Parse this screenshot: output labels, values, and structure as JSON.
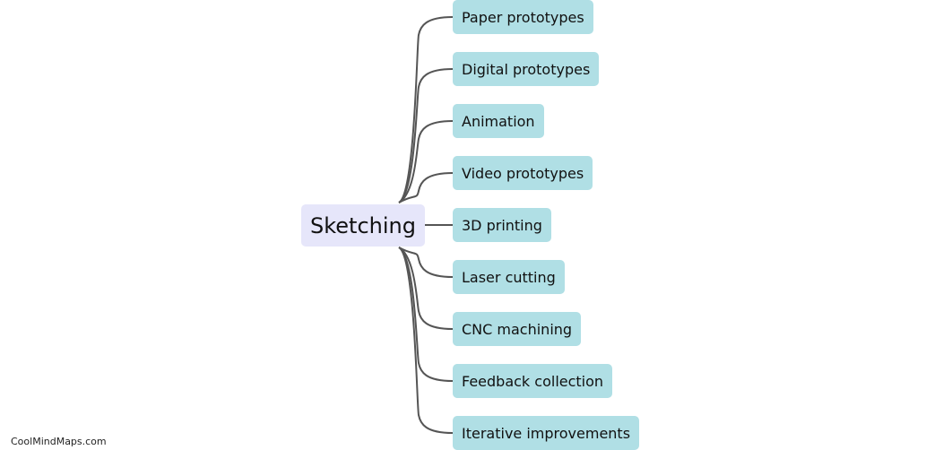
{
  "root": {
    "label": "Sketching"
  },
  "children": [
    {
      "label": "Paper prototypes"
    },
    {
      "label": "Digital prototypes"
    },
    {
      "label": "Animation"
    },
    {
      "label": "Video prototypes"
    },
    {
      "label": "3D printing"
    },
    {
      "label": "Laser cutting"
    },
    {
      "label": "CNC machining"
    },
    {
      "label": "Feedback collection"
    },
    {
      "label": "Iterative improvements"
    }
  ],
  "colors": {
    "root_fill": "#e6e6fa",
    "child_fill": "#b0dfe5",
    "link": "#555555"
  },
  "watermark": "CoolMindMaps.com"
}
